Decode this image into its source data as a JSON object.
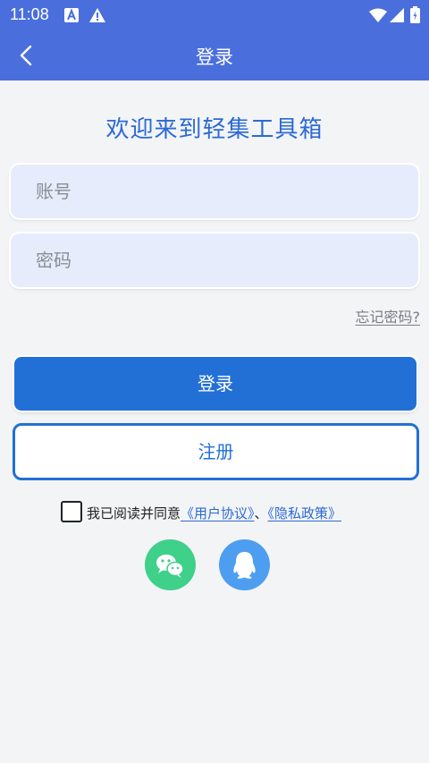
{
  "status_bar": {
    "time": "11:08",
    "icons": [
      "a-notification-icon",
      "warning-icon",
      "wifi-icon",
      "signal-icon",
      "battery-icon"
    ]
  },
  "header": {
    "title": "登录",
    "back_icon": "back-chevron-icon"
  },
  "main": {
    "welcome_text": "欢迎来到轻集工具箱",
    "account_placeholder": "账号",
    "account_value": "",
    "password_placeholder": "密码",
    "password_value": "",
    "forgot_password": "忘记密码?",
    "login_button": "登录",
    "register_button": "注册",
    "agreement": {
      "checked": false,
      "text": "我已阅读并同意",
      "user_agreement": "《用户协议》",
      "separator": "、",
      "privacy_policy": "《隐私政策》"
    },
    "social_login": [
      {
        "name": "wechat",
        "icon": "wechat-icon",
        "color": "#3fd08a"
      },
      {
        "name": "qq",
        "icon": "qq-icon",
        "color": "#4d9ef0"
      }
    ]
  },
  "colors": {
    "header_bg": "#4a6fdc",
    "accent": "#2270d6",
    "welcome_text": "#2b6ad4",
    "field_bg": "#e6ecfb",
    "page_bg": "#f3f4f6"
  }
}
